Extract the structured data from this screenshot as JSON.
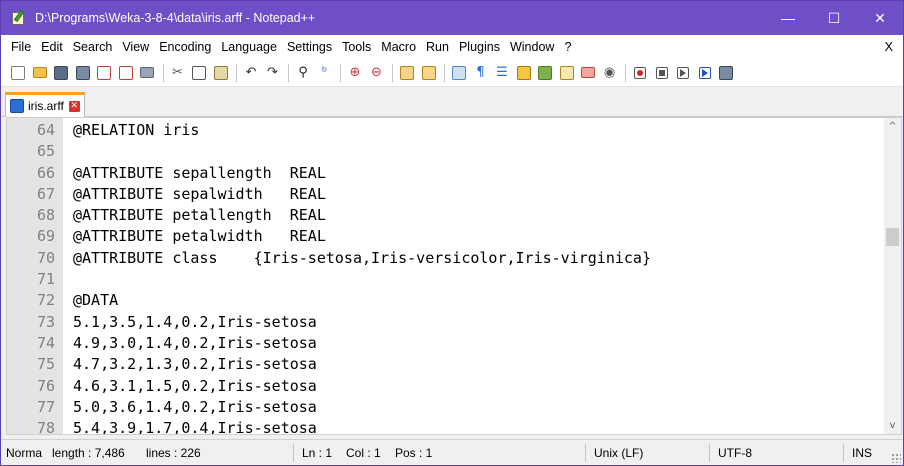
{
  "window": {
    "title": "D:\\Programs\\Weka-3-8-4\\data\\iris.arff - Notepad++",
    "minimize": "—",
    "maximize": "☐",
    "close": "✕"
  },
  "menu": {
    "items": [
      {
        "label": "File",
        "name": "menu-file"
      },
      {
        "label": "Edit",
        "name": "menu-edit"
      },
      {
        "label": "Search",
        "name": "menu-search"
      },
      {
        "label": "View",
        "name": "menu-view"
      },
      {
        "label": "Encoding",
        "name": "menu-encoding"
      },
      {
        "label": "Language",
        "name": "menu-language"
      },
      {
        "label": "Settings",
        "name": "menu-settings"
      },
      {
        "label": "Tools",
        "name": "menu-tools"
      },
      {
        "label": "Macro",
        "name": "menu-macro"
      },
      {
        "label": "Run",
        "name": "menu-run"
      },
      {
        "label": "Plugins",
        "name": "menu-plugins"
      },
      {
        "label": "Window",
        "name": "menu-window"
      },
      {
        "label": "?",
        "name": "menu-help"
      }
    ],
    "close_doc": "X"
  },
  "toolbar": {
    "icons": [
      "new-file-icon",
      "open-file-icon",
      "save-icon",
      "save-all-icon",
      "close-icon",
      "close-all-icon",
      "print-icon",
      "cut-icon",
      "copy-icon",
      "paste-icon",
      "undo-icon",
      "redo-icon",
      "find-icon",
      "replace-icon",
      "zoom-in-icon",
      "zoom-out-icon",
      "sync-vertical-icon",
      "sync-horizontal-icon",
      "word-wrap-icon",
      "show-all-chars-icon",
      "indent-guide-icon",
      "udl-icon",
      "doc-map-icon",
      "function-list-icon",
      "folder-workspace-icon",
      "monitoring-icon",
      "record-macro-icon",
      "stop-macro-icon",
      "play-macro-icon",
      "run-macro-multiple-icon",
      "save-macro-icon"
    ]
  },
  "tab": {
    "label": "iris.arff",
    "close": "✕"
  },
  "editor": {
    "line_numbers": [
      "64",
      "65",
      "66",
      "67",
      "68",
      "69",
      "70",
      "71",
      "72",
      "73",
      "74",
      "75",
      "76",
      "77",
      "78"
    ],
    "lines": [
      "@RELATION iris",
      "",
      "@ATTRIBUTE sepallength  REAL",
      "@ATTRIBUTE sepalwidth   REAL",
      "@ATTRIBUTE petallength  REAL",
      "@ATTRIBUTE petalwidth   REAL",
      "@ATTRIBUTE class    {Iris-setosa,Iris-versicolor,Iris-virginica}",
      "",
      "@DATA",
      "5.1,3.5,1.4,0.2,Iris-setosa",
      "4.9,3.0,1.4,0.2,Iris-setosa",
      "4.7,3.2,1.3,0.2,Iris-setosa",
      "4.6,3.1,1.5,0.2,Iris-setosa",
      "5.0,3.6,1.4,0.2,Iris-setosa",
      "5.4,3.9,1.7,0.4,Iris-setosa"
    ],
    "scroll_up": "^",
    "scroll_down": "v"
  },
  "status": {
    "doc_type": "Norma",
    "length": "length : 7,486",
    "lines": "lines : 226",
    "ln": "Ln : 1",
    "col": "Col : 1",
    "pos": "Pos : 1",
    "eol": "Unix (LF)",
    "encoding": "UTF-8",
    "mode": "INS"
  }
}
